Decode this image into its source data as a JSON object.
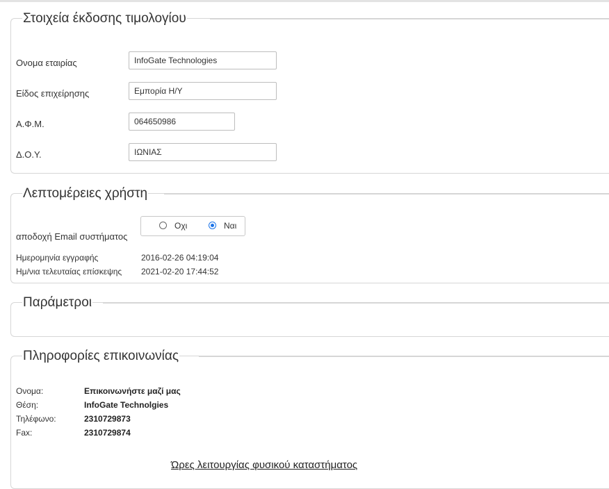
{
  "invoice": {
    "title": "Στοιχεία έκδοσης τιμολογίου",
    "fields": [
      {
        "label": "Ονομα εταιρίας",
        "value": "InfoGate Technologies"
      },
      {
        "label": "Είδος επιχείρησης",
        "value": "Εμπορία Η/Υ"
      },
      {
        "label": "Α.Φ.Μ.",
        "value": "064650986"
      },
      {
        "label": "Δ.Ο.Υ.",
        "value": "ΙΩΝΙΑΣ"
      }
    ]
  },
  "user": {
    "title": "Λεπτομέρειες χρήστη",
    "email_label": "αποδοχή Email συστήματος",
    "option_no": "Οχι",
    "option_yes": "Ναι",
    "selected": "yes",
    "registration_label": "Ημερομηνία εγγραφής",
    "registration_value": "2016-02-26 04:19:04",
    "last_visit_label": "Ημ/νια τελευταίας επίσκεψης",
    "last_visit_value": "2021-02-20 17:44:52"
  },
  "params": {
    "title": "Παράμετροι"
  },
  "contact": {
    "title": "Πληροφορίες επικοινωνίας",
    "rows": [
      {
        "label": "Ονομα:",
        "value": "Επικοινωνήστε μαζί μας"
      },
      {
        "label": "Θέση:",
        "value": "InfoGate Technolgies"
      },
      {
        "label": "Τηλέφωνο:",
        "value": "2310729873"
      },
      {
        "label": "Fax:",
        "value": "2310729874"
      }
    ],
    "hours_link": "Ώρες λειτουργίας φυσικού καταστήματος"
  }
}
